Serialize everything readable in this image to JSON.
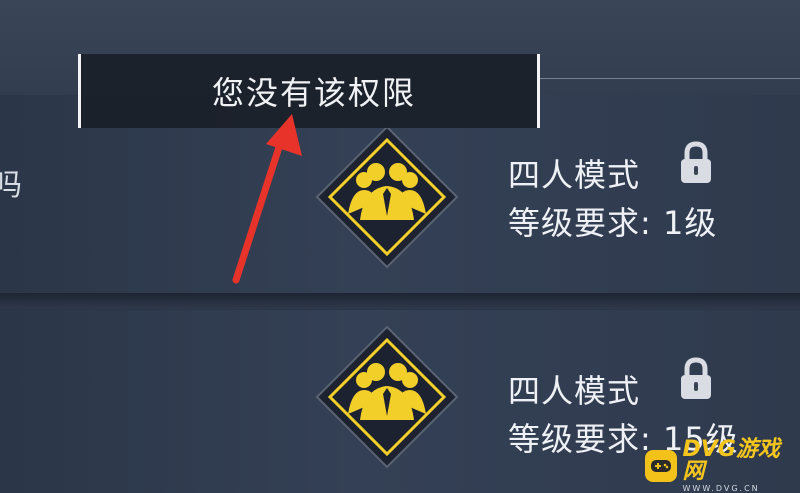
{
  "tooltip": {
    "text": "您没有该权限"
  },
  "left_edge_text": "吗",
  "modes": [
    {
      "title": "四人模式",
      "requirement": "等级要求: 1级",
      "locked": true
    },
    {
      "title": "四人模式",
      "requirement": "等级要求: 15级",
      "locked": true
    }
  ],
  "icons": {
    "mode": "team-icon",
    "lock": "lock-icon",
    "pointer": "red-arrow-icon"
  },
  "colors": {
    "gold": "#f3cf2a",
    "arrow": "#e8332b",
    "panel": "#2f3a4d",
    "tooltip_bg": "#1a1f28"
  },
  "watermark": {
    "title": "DVG游戏网",
    "url": "WWW.DVG.CN"
  }
}
